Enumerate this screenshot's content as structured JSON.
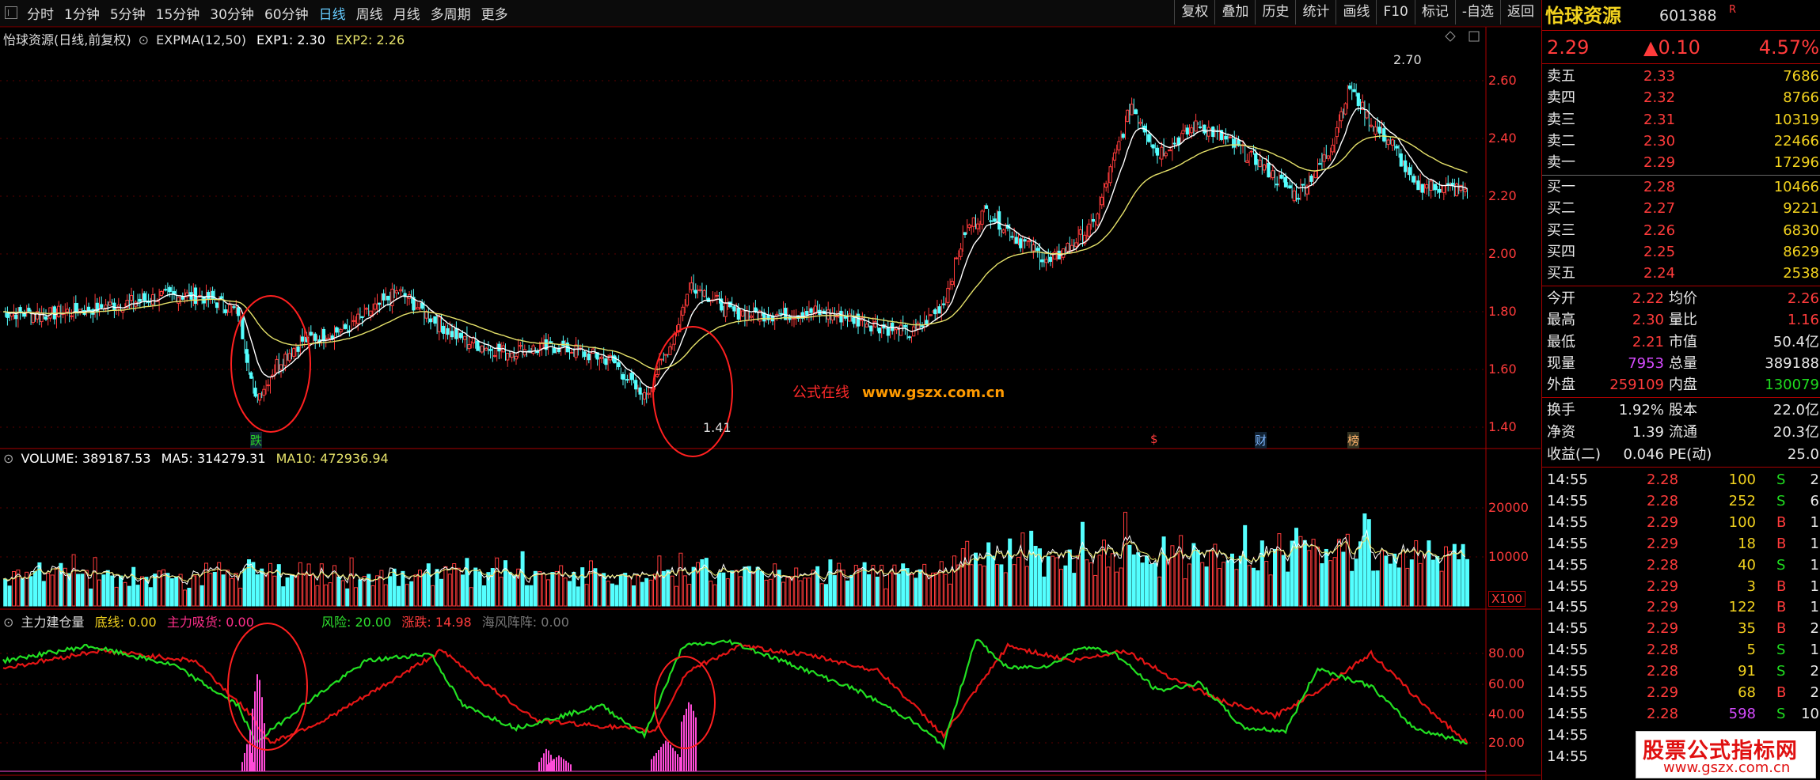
{
  "toolbar": {
    "periods": [
      "分时",
      "1分钟",
      "5分钟",
      "15分钟",
      "30分钟",
      "60分钟",
      "日线",
      "周线",
      "月线",
      "多周期",
      "更多"
    ],
    "active_period": "日线",
    "tools": [
      "复权",
      "叠加",
      "历史",
      "统计",
      "画线",
      "F10",
      "标记",
      "-自选",
      "返回"
    ]
  },
  "main_chart": {
    "title": "怡球资源(日线,前复权)",
    "indicator": "EXPMA(12,50)",
    "exp1": "EXP1: 2.30",
    "exp2": "EXP2: 2.26",
    "y_ticks": [
      "2.60",
      "2.40",
      "2.20",
      "2.00",
      "1.80",
      "1.60",
      "1.40"
    ],
    "high_label": "2.70",
    "low_label": "1.41",
    "markers": {
      "die": "跌",
      "s": "$",
      "cai": "财",
      "bang": "榜"
    },
    "colors": {
      "up": "#ff3b3b",
      "down": "#54ffff",
      "exp1": "#ffffff",
      "exp2": "#e6e26a"
    }
  },
  "volume_chart": {
    "vol": "VOLUME: 389187.53",
    "ma5": "MA5: 314279.31",
    "ma10": "MA10: 472936.94",
    "y_ticks": [
      "20000",
      "10000"
    ],
    "unit": "X100"
  },
  "indicator_chart": {
    "name": "主力建仓量",
    "dixian": "底线: 0.00",
    "zhuli": "主力吸货: 0.00",
    "risk": "风险: 20.00",
    "zhangdie": "涨跌: 14.98",
    "haifeng": "海风阵阵: 0.00",
    "y_ticks": [
      "80.00",
      "60.00",
      "40.00",
      "20.00"
    ]
  },
  "watermark": {
    "cn": "公式在线",
    "url": "www.gszx.com.cn"
  },
  "logo": {
    "line1": "股票公式指标网",
    "line2": "www.gszx.com.cn"
  },
  "quote": {
    "name": "怡球资源",
    "code": "601388",
    "flag": "R",
    "price": "2.29",
    "change": "▲0.10",
    "pct": "4.57%",
    "asks": [
      {
        "label": "卖五",
        "price": "2.33",
        "vol": "7686"
      },
      {
        "label": "卖四",
        "price": "2.32",
        "vol": "8766"
      },
      {
        "label": "卖三",
        "price": "2.31",
        "vol": "10319"
      },
      {
        "label": "卖二",
        "price": "2.30",
        "vol": "22466"
      },
      {
        "label": "卖一",
        "price": "2.29",
        "vol": "17296"
      }
    ],
    "bids": [
      {
        "label": "买一",
        "price": "2.28",
        "vol": "10466"
      },
      {
        "label": "买二",
        "price": "2.27",
        "vol": "9221"
      },
      {
        "label": "买三",
        "price": "2.26",
        "vol": "6830"
      },
      {
        "label": "买四",
        "price": "2.25",
        "vol": "8629"
      },
      {
        "label": "买五",
        "price": "2.24",
        "vol": "2538"
      }
    ],
    "stats": [
      {
        "l1": "今开",
        "v1": "2.22",
        "l2": "均价",
        "v2": "2.26"
      },
      {
        "l1": "最高",
        "v1": "2.30",
        "l2": "量比",
        "v2": "1.16"
      },
      {
        "l1": "最低",
        "v1": "2.21",
        "l2": "市值",
        "v2": "50.4亿"
      },
      {
        "l1": "现量",
        "v1": "7953",
        "l2": "总量",
        "v2": "389188"
      },
      {
        "l1": "外盘",
        "v1": "259109",
        "l2": "内盘",
        "v2": "130079"
      }
    ],
    "stats2": [
      {
        "l1": "换手",
        "v1": "1.92%",
        "l2": "股本",
        "v2": "22.0亿"
      },
      {
        "l1": "净资",
        "v1": "1.39",
        "l2": "流通",
        "v2": "20.3亿"
      },
      {
        "l1": "收益(二)",
        "v1": "0.046",
        "l2": "PE(动)",
        "v2": "25.0"
      }
    ],
    "ticks": [
      {
        "t": "14:55",
        "p": "2.28",
        "v": "100",
        "s": "S",
        "n": "2"
      },
      {
        "t": "14:55",
        "p": "2.28",
        "v": "252",
        "s": "S",
        "n": "6"
      },
      {
        "t": "14:55",
        "p": "2.29",
        "v": "100",
        "s": "B",
        "n": "1"
      },
      {
        "t": "14:55",
        "p": "2.29",
        "v": "18",
        "s": "B",
        "n": "1"
      },
      {
        "t": "14:55",
        "p": "2.28",
        "v": "40",
        "s": "S",
        "n": "1"
      },
      {
        "t": "14:55",
        "p": "2.29",
        "v": "3",
        "s": "B",
        "n": "1"
      },
      {
        "t": "14:55",
        "p": "2.29",
        "v": "122",
        "s": "B",
        "n": "1"
      },
      {
        "t": "14:55",
        "p": "2.29",
        "v": "35",
        "s": "B",
        "n": "2"
      },
      {
        "t": "14:55",
        "p": "2.28",
        "v": "5",
        "s": "S",
        "n": "1"
      },
      {
        "t": "14:55",
        "p": "2.28",
        "v": "91",
        "s": "S",
        "n": "2"
      },
      {
        "t": "14:55",
        "p": "2.29",
        "v": "68",
        "s": "B",
        "n": "2"
      },
      {
        "t": "14:55",
        "p": "2.28",
        "v": "598",
        "s": "S",
        "n": "10"
      },
      {
        "t": "14:55",
        "p": "",
        "v": "",
        "s": "",
        "n": ""
      },
      {
        "t": "14:55",
        "p": "",
        "v": "",
        "s": "",
        "n": ""
      }
    ]
  }
}
